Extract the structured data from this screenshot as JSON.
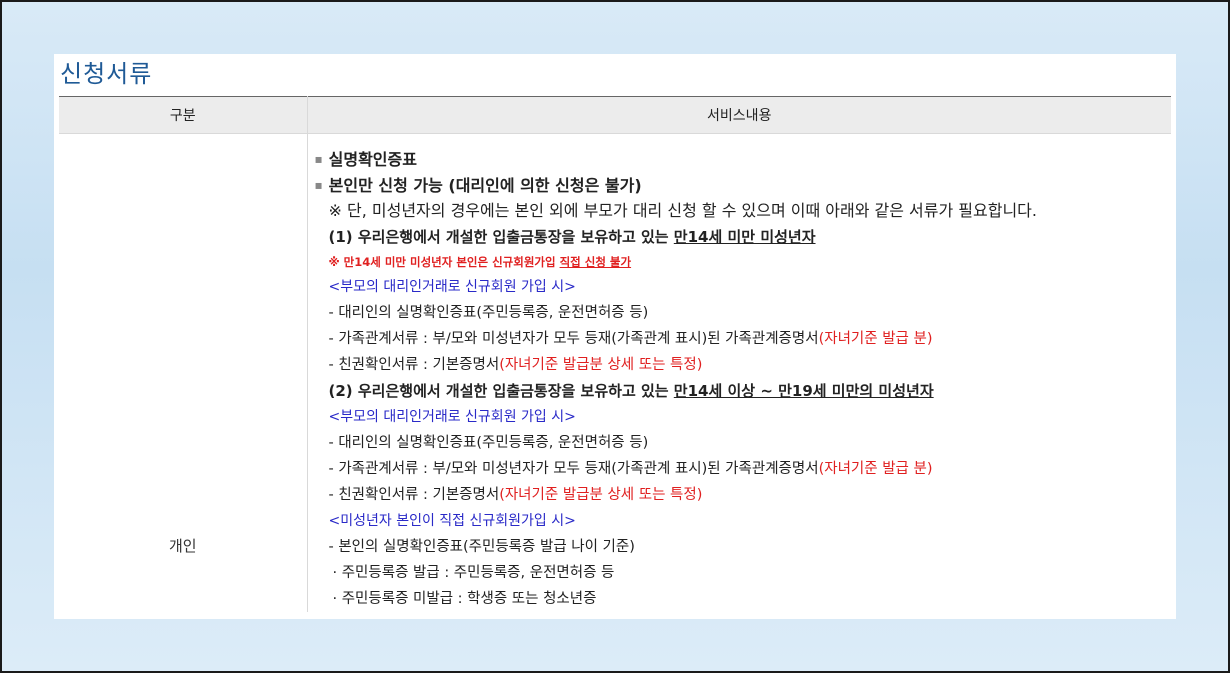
{
  "title": "신청서류",
  "table": {
    "header_category": "구분",
    "header_content": "서비스내용",
    "category": "개인"
  },
  "content": {
    "bullet1": "실명확인증표",
    "bullet2": "본인만 신청 가능 (대리인에 의한 신청은 불가)",
    "note": "※ 단, 미성년자의 경우에는 본인 외에 부모가 대리 신청 할 수 있으며 이때 아래와 같은 서류가 필요합니다.",
    "sec1_prefix": "(1) 우리은행에서 개설한 입출금통장을 보유하고 있는 ",
    "sec1_underlined": "만14세 미만 미성년자",
    "warn_prefix": "※ 만14세 미만 미성년자 본인은 신규회원가입 ",
    "warn_underlined": "직접 신청 불가",
    "sub1": "<부모의 대리인거래로 신규회원 가입 시>",
    "s1_item1": "- 대리인의 실명확인증표(주민등록증, 운전면허증 등)",
    "s1_item2_text": "- 가족관계서류 : 부/모와 미성년자가 모두 등재(가족관계 표시)된 가족관계증명서",
    "s1_item2_red": "(자녀기준 발급 분)",
    "s1_item3_text": "- 친권확인서류 : 기본증명서",
    "s1_item3_red": "(자녀기준 발급분 상세 또는 특정)",
    "sec2_prefix": "(2) 우리은행에서 개설한 입출금통장을 보유하고 있는 ",
    "sec2_underlined": "만14세 이상 ~ 만19세 미만의 미성년자",
    "sub2": "<부모의 대리인거래로 신규회원 가입 시>",
    "s2_item1": "- 대리인의 실명확인증표(주민등록증, 운전면허증 등)",
    "s2_item2_text": "- 가족관계서류 : 부/모와 미성년자가 모두 등재(가족관계 표시)된 가족관계증명서",
    "s2_item2_red": "(자녀기준 발급 분)",
    "s2_item3_text": "- 친권확인서류 : 기본증명서",
    "s2_item3_red": "(자녀기준 발급분 상세 또는 특정)",
    "sub3": "<미성년자 본인이 직접 신규회원가입 시>",
    "s3_item1": "- 본인의 실명확인증표(주민등록증 발급 나이 기준)",
    "s3_item2": "· 주민등록증 발급 : 주민등록증, 운전면허증 등",
    "s3_item3": "· 주민등록증 미발급 : 학생증 또는 청소년증"
  },
  "colors": {
    "title": "#1f5a96",
    "warning_red": "#e02020",
    "sub_blue": "#2a2ac8"
  }
}
